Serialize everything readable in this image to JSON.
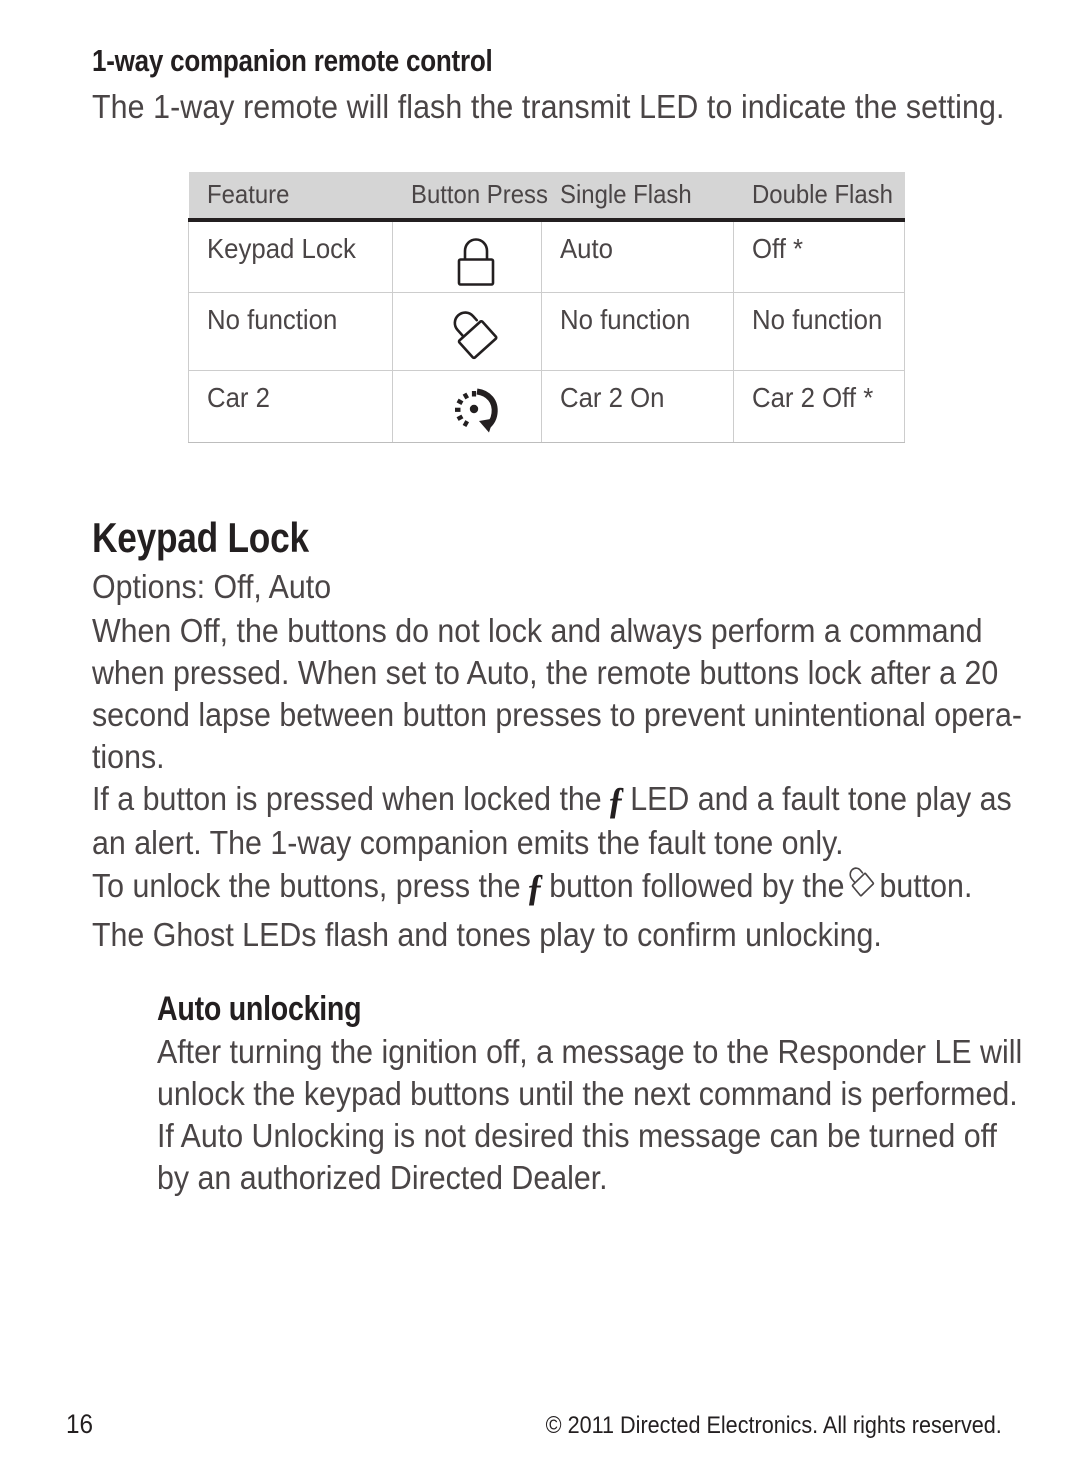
{
  "page": {
    "number": "16",
    "copyright": "© 2011 Directed Electronics. All rights reserved."
  },
  "section_one_way": {
    "title": "1-way companion remote control",
    "intro": "The 1-way remote will flash the transmit LED to indicate the setting."
  },
  "table": {
    "headers": [
      "Feature",
      "Button Press",
      "Single Flash",
      "Double Flash"
    ],
    "rows": [
      {
        "feature": "Keypad Lock",
        "icon": "padlock-locked-icon",
        "single_flash": "Auto",
        "double_flash": "Off *"
      },
      {
        "feature": "No function",
        "icon": "padlock-unlocked-icon",
        "single_flash": "No function",
        "double_flash": "No function"
      },
      {
        "feature": "Car 2",
        "icon": "car-two-dial-arrow-icon",
        "single_flash": "Car 2 On",
        "double_flash": "Car 2 Off *"
      }
    ]
  },
  "keypad_lock": {
    "heading": "Keypad Lock",
    "options_line": "Options: Off, Auto",
    "paragraph_when": [
      "When Off, the buttons do not lock and always perform a command",
      "when pressed. When set to Auto, the remote buttons lock after a 20",
      "second lapse between button presses to prevent unintentional opera-",
      "tions."
    ],
    "paragraph_if": {
      "line1_before": "If a button is pressed when locked the",
      "glyph": "ƒ",
      "line1_after": "LED and a fault tone play as",
      "line2": "an alert. The 1-way companion emits the fault tone only."
    },
    "paragraph_unlock": {
      "line1_a": "To unlock the buttons, press the",
      "glyph": "ƒ",
      "line1_b": "button followed by the",
      "icon": "padlock-unlocked-icon",
      "line1_c": "button.",
      "line2": "The Ghost LEDs flash and tones play to confirm unlocking."
    }
  },
  "auto_unlocking": {
    "heading": "Auto unlocking",
    "paragraph": [
      "After turning the ignition off, a message to the Responder LE will",
      "unlock the keypad buttons until the next command is performed.",
      "If Auto Unlocking is not desired this message can be turned off",
      "by an authorized Directed Dealer."
    ]
  },
  "colors": {
    "body_text": "#4a4546",
    "heading_text": "#231f20",
    "table_header_bg": "#d5d5d5",
    "table_border": "#cdcdcd",
    "table_header_rule": "#231f20",
    "page_bg": "#ffffff"
  }
}
